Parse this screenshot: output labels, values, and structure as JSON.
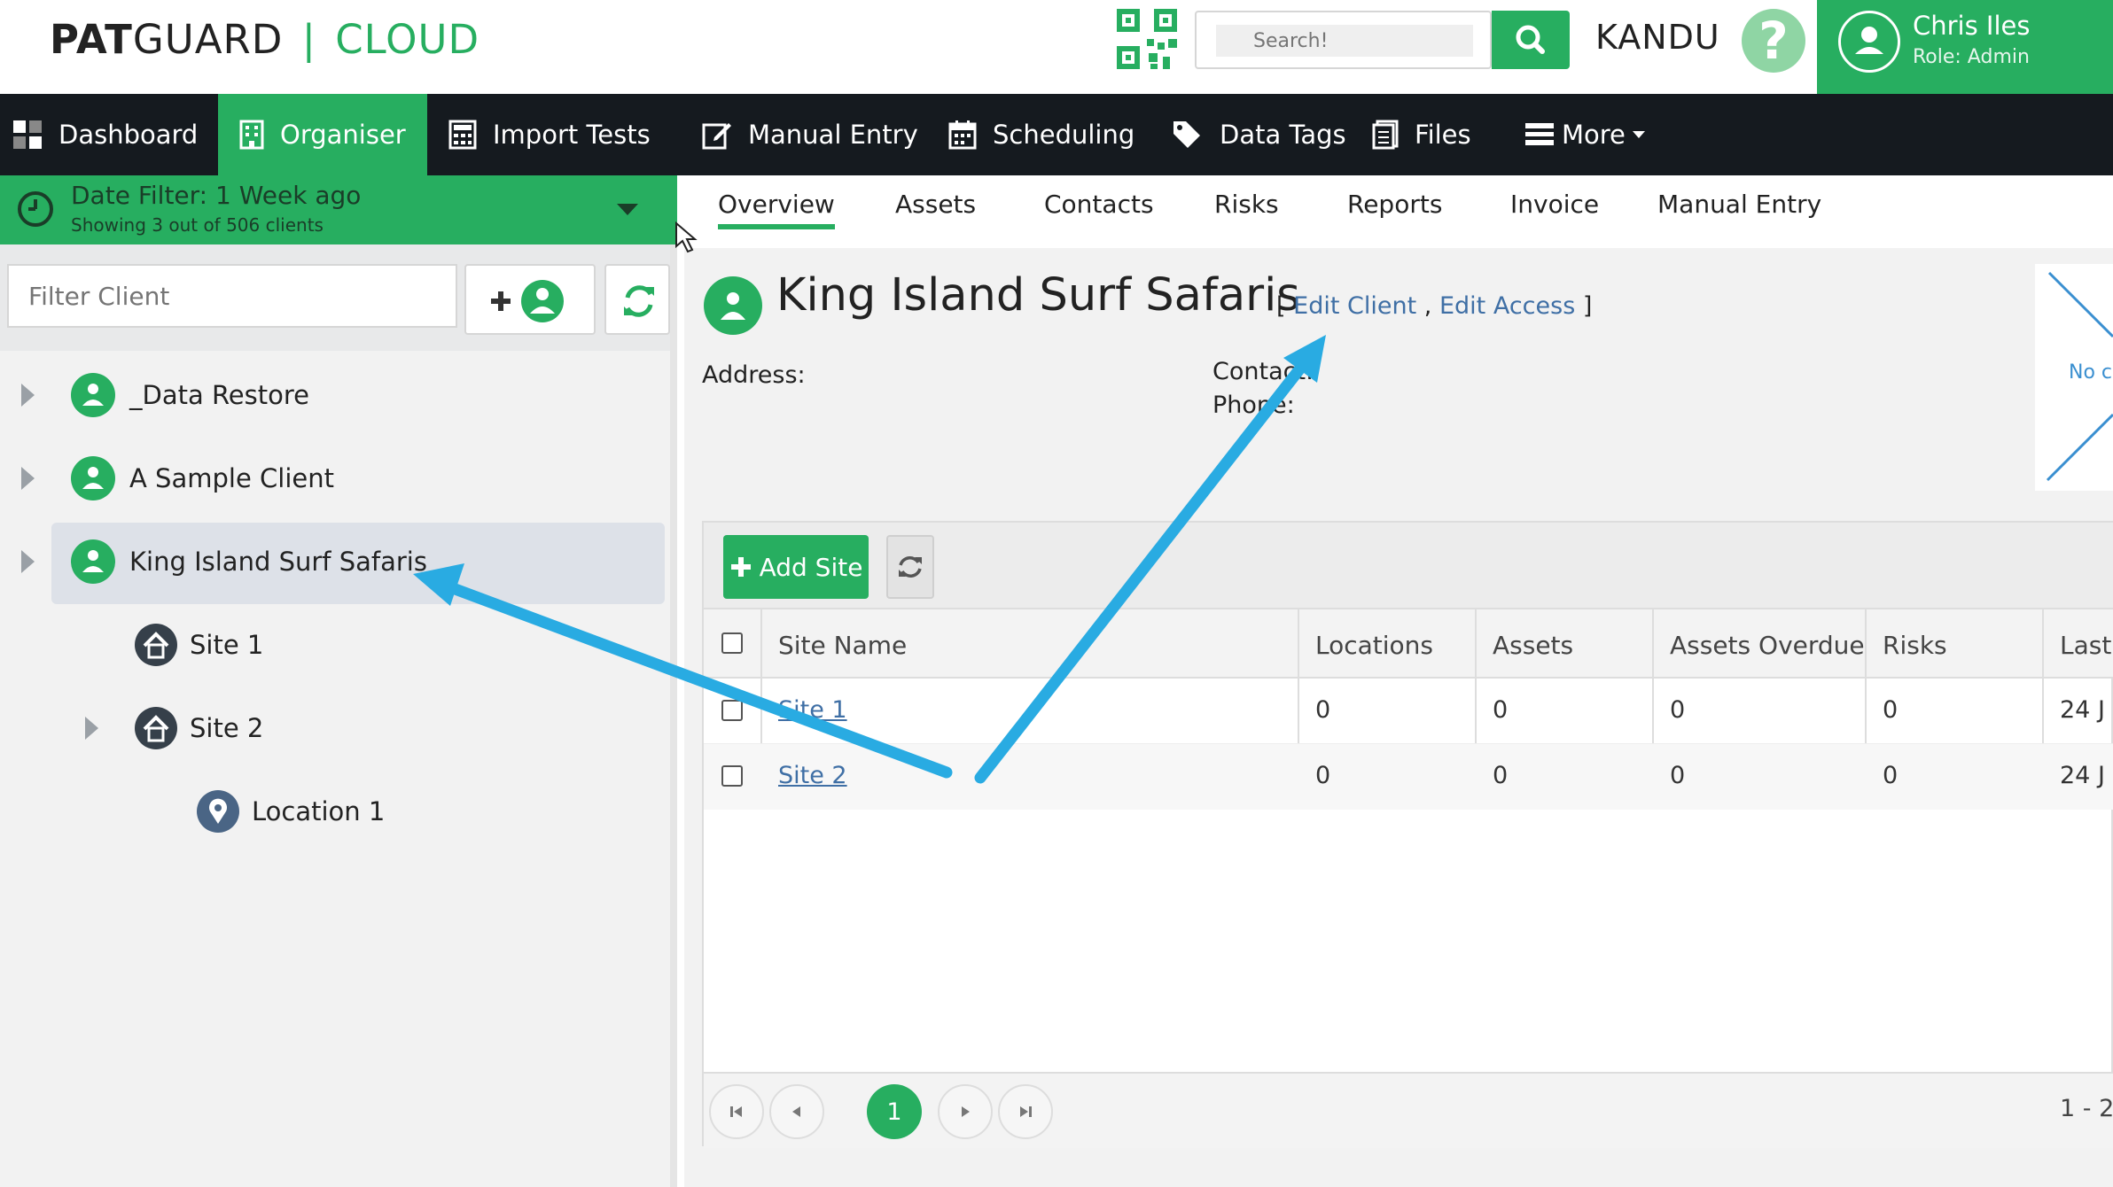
{
  "brand": {
    "part1": "PAT",
    "part2": "GUARD",
    "separator": "|",
    "part3": "CLOUD"
  },
  "header": {
    "search_placeholder": "Search!",
    "org_name": "KANDU",
    "help_label": "?",
    "user_name": "Chris Iles",
    "user_role": "Role: Admin"
  },
  "nav": {
    "dashboard": "Dashboard",
    "organiser": "Organiser",
    "import_tests": "Import Tests",
    "manual_entry": "Manual Entry",
    "scheduling": "Scheduling",
    "data_tags": "Data Tags",
    "files": "Files",
    "more": "More"
  },
  "sidebar": {
    "date_filter_title": "Date Filter: 1 Week ago",
    "date_filter_sub": "Showing 3 out of 506 clients",
    "filter_placeholder": "Filter Client",
    "tree": {
      "client1": "_Data Restore",
      "client2": "A Sample Client",
      "client3": "King Island Surf Safaris",
      "site1": "Site 1",
      "site2": "Site 2",
      "location1": "Location 1"
    }
  },
  "subtabs": {
    "overview": "Overview",
    "assets": "Assets",
    "contacts": "Contacts",
    "risks": "Risks",
    "reports": "Reports",
    "invoice": "Invoice",
    "manual_entry": "Manual Entry"
  },
  "client": {
    "name": "King Island Surf Safaris",
    "bracket_open": "[",
    "edit_client": "Edit Client",
    "comma": ",",
    "edit_access": "Edit Access",
    "bracket_close": "]",
    "address_label": "Address:",
    "contact_label": "Contact:",
    "phone_label": "Phone:",
    "image_placeholder": "No c"
  },
  "sites": {
    "add_site_label": "Add Site",
    "columns": {
      "site_name": "Site Name",
      "locations": "Locations",
      "assets": "Assets",
      "assets_overdue": "Assets Overdue",
      "risks": "Risks",
      "last": "Last"
    },
    "rows": [
      {
        "site_name": "Site 1",
        "locations": "0",
        "assets": "0",
        "assets_overdue": "0",
        "risks": "0",
        "last": "24 J"
      },
      {
        "site_name": "Site 2",
        "locations": "0",
        "assets": "0",
        "assets_overdue": "0",
        "risks": "0",
        "last": "24 J"
      }
    ],
    "pager": {
      "current_page": "1",
      "info": "1 - 2"
    }
  },
  "colors": {
    "accent": "#27ae60",
    "nav_bg": "#151a1f",
    "annotation_arrow": "#29abe2"
  }
}
